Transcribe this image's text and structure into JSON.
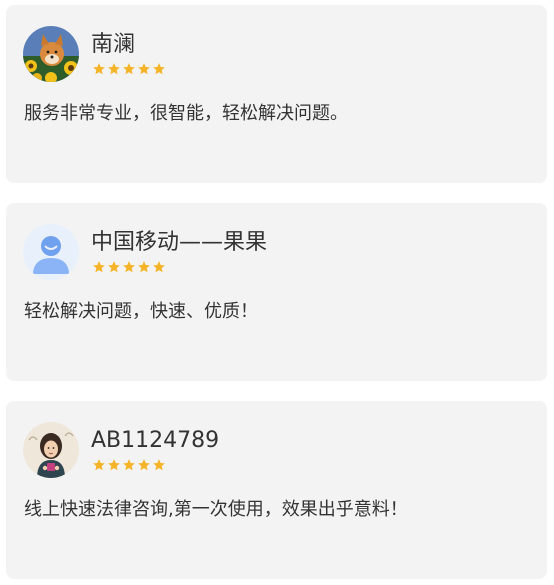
{
  "colors": {
    "card_background": "#f3f3f3",
    "star": "#f5b427",
    "text": "#333333"
  },
  "reviews": [
    {
      "username": "南澜",
      "avatar": "shiba-dog-sunflowers-avatar",
      "stars": 5,
      "text": "服务非常专业，很智能，轻松解决问题。"
    },
    {
      "username": "中国移动——果果",
      "avatar": "default-user-avatar",
      "stars": 5,
      "text": "轻松解决问题，快速、优质！"
    },
    {
      "username": "AB1124789",
      "avatar": "illustrated-person-avatar",
      "stars": 5,
      "text": "线上快速法律咨询,第一次使用，效果出乎意料！"
    }
  ]
}
